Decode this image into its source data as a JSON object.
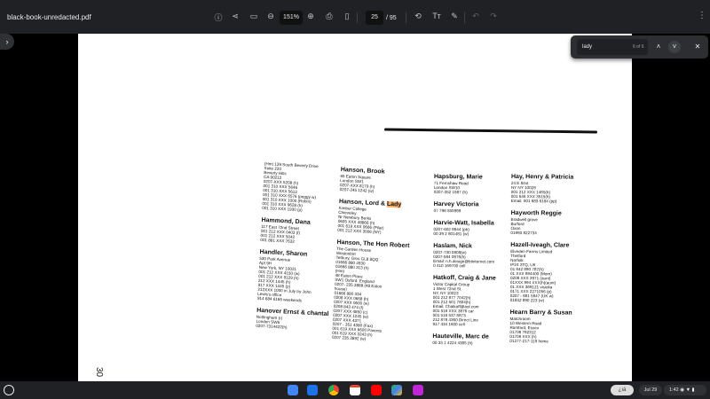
{
  "toolbar": {
    "title": "black-book-unredacted.pdf",
    "zoom": "151%",
    "page": "25",
    "page_total": "/ 95",
    "icons": [
      "info",
      "share",
      "fit-page",
      "zoom-out",
      "zoom-in",
      "print",
      "download",
      "rotate",
      "text",
      "annotate",
      "undo",
      "redo"
    ]
  },
  "find": {
    "query": "lady",
    "count": "6 of 6"
  },
  "pdf": {
    "page_number": "30",
    "columns": [
      [
        {
          "name": "",
          "lines": [
            "(Hm) 139 South Beverly Drive",
            "Suite 220",
            "Beverly Hills",
            "CA 90212",
            "0207-XXX 5208 (h)",
            "001 310 XXX 5646",
            "001 310 XXX 5613",
            "001 310 XXX 6576 (peggy w)",
            "001 310 XXX 1000 (Robin)",
            "001 310 XXX 9628 (h)",
            "001 310 XXX 1930 (p)"
          ]
        },
        {
          "name": "Hammond, Dana",
          "lines": [
            "117 East 72nd Street",
            "001 212 XXX 0403 (f)",
            "001 212 XXX 5042",
            "001 881 XXX 7632"
          ]
        },
        {
          "name": "Handler, Sharon",
          "lines": [
            "530 Park Avenue",
            "Apt 9H",
            "New York, NY 10021",
            "001 212 XXX 4150 (w)",
            "001 212 XXX 9129 (h)",
            "212 XXX 1445 (h)",
            "917 XXX 1445 (p)",
            "212XXX 1000 in July try John",
            "Lewis's office",
            "914 684 6165 weekends"
          ]
        },
        {
          "name": "Hanover Ernst & chantal",
          "lines": [
            "Nottingham (r)",
            "London SW6",
            "0207-7314422(h)"
          ]
        }
      ],
      [
        {
          "name": "Hanson, Brook",
          "lines": [
            "65 Eaton Square",
            "London SW1",
            "0207-XXX 8179 (h)",
            "0207-245 1242 (w)"
          ]
        },
        {
          "name": "Hanson, Lord & ",
          "hl": "Lady",
          "lines": [
            "Kimber College",
            "Chieveley",
            "Nr Newbury Berks",
            "0635 XXX 48866 (h)",
            "001 619 XXX 0666 (Pilar)",
            "001 212 XXX 3006 (NY)"
          ]
        },
        {
          "name": "Hanson, The Hon Robert",
          "lines": [
            "The Garden House",
            "Westonbirt",
            "Tetbury, Glos GL8 8QQ",
            "01666 880 4930",
            "01666 880 313 (h)",
            "(Hm)",
            "48 Eaton Place",
            "SW1 Oxford, England",
            "0207- 235 3888 (48 Eaton",
            "house)",
            "01666 880 334",
            "0208 XXX 0668 (h)",
            "0207 XXX 0600 (w)",
            "0208 843 474 (f)",
            "0207 XXX 4850 (c)",
            "0207 XXX 1245 (w)",
            "0207 XXX 4371",
            "0207 - 351 4380 (Fax)",
            "001 619 XXX 6600 Parents",
            "001 619 XXX 3243 (h)",
            "0207 235 3892 (w)"
          ]
        }
      ],
      [
        {
          "name": "Hapsburg, Marie",
          "lines": [
            "71 Fernshaw Road",
            "London SW10",
            "0207-352 1987 (h)"
          ]
        },
        {
          "name": "Harvey Victoria",
          "lines": [
            "07 798 555999"
          ]
        },
        {
          "name": "Harvie-Watt, Isabella",
          "lines": [
            "0207-602 8944 (ph)",
            "00 39 2 801481 (w)"
          ]
        },
        {
          "name": "Haslam, Nick",
          "lines": [
            "0207-730 0808(w)",
            "0207-584 0976(h)",
            "Email: n.h.design@btinternet.com",
            "0 410 169700 cell"
          ]
        },
        {
          "name": "Hatkoff, Craig & Jane",
          "lines": [
            "Victor Capital Group",
            "1 West 72nd St.",
            "NY, NY 10023",
            "001 212 877 7042(h)",
            "001 212 501 7804(h)",
            "Email: Chatkoff@aol.com",
            "001 516 XXX 3876 car",
            "001 516 537 8873",
            "212 878 4360 Direct Line",
            "917 434 1600 cell"
          ]
        },
        {
          "name": "Hauteville, Marc de",
          "lines": [
            "00 33 1 4224 4385 (h)"
          ]
        }
      ],
      [
        {
          "name": "Hay, Henry & Patricia",
          "lines": [
            "24 E 84st",
            "NY NY 10028",
            "001 212 XXX 1465(h)",
            "001 646 XXX 3515(h)",
            "Email: 001 683 6194 (pp)"
          ]
        },
        {
          "name": "Hayworth Reggie",
          "lines": [
            "Bradwell grove",
            "Burford",
            "Oxon",
            "01993 822734"
          ]
        },
        {
          "name": "Hazell-Iveagh, Clare",
          "lines": [
            "Elveden Farms Limited",
            "Thetford",
            "Norfolk",
            "IP24 3TQ, UK",
            "01 842 890 787(h)",
            "01 XXX 894400 (Mom)",
            "0208 XXX 3971 (aunt)",
            "01XXX 894 XXX(h)(aunt)",
            "01 XXX 369121 visiolia",
            "0171 XXX 2271056 (p)",
            "0207 - 881 5847 (UK w)",
            "01842 890 223 (w)"
          ]
        },
        {
          "name": "Hearn Barry & Susan",
          "lines": [
            "Matchroom",
            "10 Western Road",
            "Romford, Essex",
            "01708 782312",
            "01708 XXX (h)",
            "01277-217-119 home"
          ]
        }
      ]
    ]
  },
  "taskbar": {
    "tray": "¿ıá",
    "date": "Jul 29",
    "time": "1:42"
  }
}
